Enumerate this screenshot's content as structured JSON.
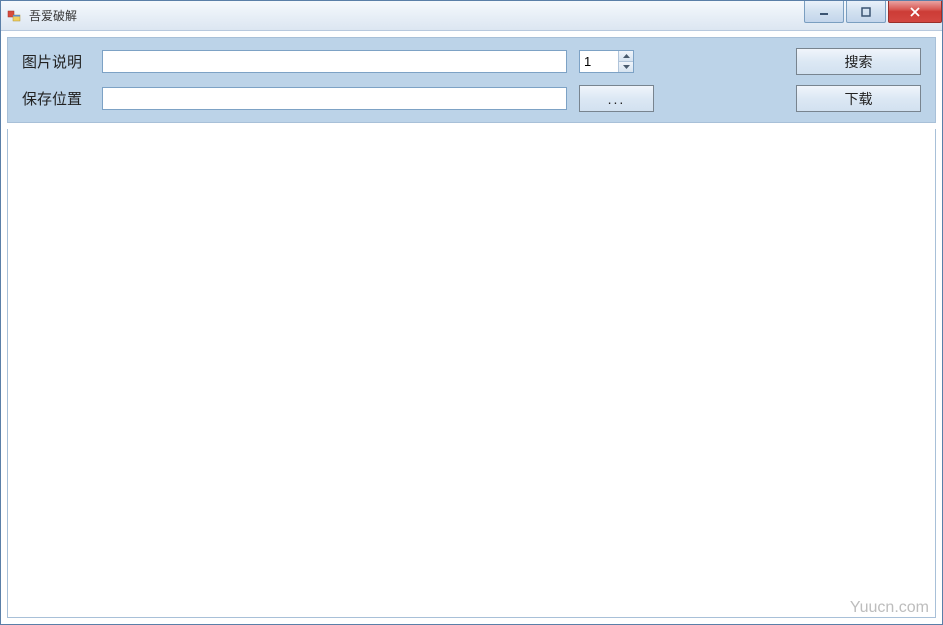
{
  "window": {
    "title": "吾爱破解"
  },
  "toolbar": {
    "desc_label": "图片说明",
    "desc_value": "",
    "count_value": "1",
    "search_label": "搜索",
    "save_label": "保存位置",
    "save_value": "",
    "browse_label": "...",
    "download_label": "下载"
  },
  "watermark": "Yuucn.com"
}
